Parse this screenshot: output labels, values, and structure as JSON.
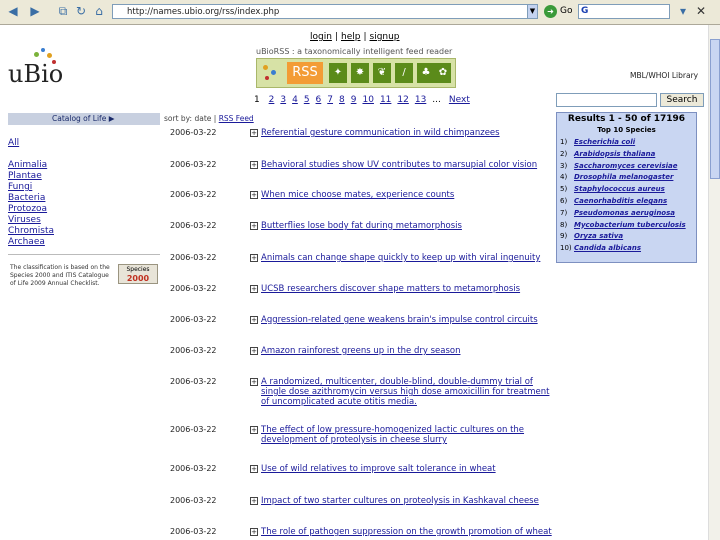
{
  "browser": {
    "address": "http://names.ubio.org/rss/index.php",
    "go_label": "Go",
    "search_value": "G"
  },
  "header": {
    "login": "login",
    "help": "help",
    "signup": "signup",
    "tagline": "uBioRSS : a taxonomically intelligent feed reader",
    "logo_text": "uBio",
    "rss_label": "RSS",
    "affiliation": "MBL/WHOI Library"
  },
  "pager": {
    "pages": [
      "2",
      "3",
      "4",
      "5",
      "6",
      "7",
      "8",
      "9",
      "10",
      "11",
      "12",
      "13"
    ],
    "current": "1",
    "ellipsis": "...",
    "next": "Next"
  },
  "search": {
    "button": "Search"
  },
  "catalog": {
    "label": "Catalog of Life ▶",
    "sort_text": "sort by: date |",
    "rss_feed": "RSS Feed",
    "items": [
      "All",
      "Animalia",
      "Plantae",
      "Fungi",
      "Bacteria",
      "Protozoa",
      "Viruses",
      "Chromista",
      "Archaea"
    ],
    "note": "The classification is based on the Species 2000 and ITIS Catalogue of Life 2009 Annual Checklist.",
    "badge_top": "Species",
    "badge_bottom": "2000"
  },
  "feeds": [
    {
      "date": "2006-03-22",
      "title": "Referential gesture communication in wild chimpanzees"
    },
    {
      "date": "2006-03-22",
      "title": "Behavioral studies show UV contributes to marsupial color vision"
    },
    {
      "date": "2006-03-22",
      "title": "When mice choose mates, experience counts"
    },
    {
      "date": "2006-03-22",
      "title": "Butterflies lose body fat during metamorphosis"
    },
    {
      "date": "2006-03-22",
      "title": "Animals can change shape quickly to keep up with viral ingenuity"
    },
    {
      "date": "2006-03-22",
      "title": "UCSB researchers discover shape matters to metamorphosis"
    },
    {
      "date": "2006-03-22",
      "title": "Aggression-related gene weakens brain's impulse control circuits"
    },
    {
      "date": "2006-03-22",
      "title": "Amazon rainforest greens up in the dry season"
    },
    {
      "date": "2006-03-22",
      "title": "A randomized, multicenter, double-blind, double-dummy trial of single dose azithromycin versus high dose amoxicillin for treatment of uncomplicated acute otitis media."
    },
    {
      "date": "2006-03-22",
      "title": "The effect of low pressure-homogenized lactic cultures on the development of proteolysis in cheese slurry"
    },
    {
      "date": "2006-03-22",
      "title": "Use of wild relatives to improve salt tolerance in wheat"
    },
    {
      "date": "2006-03-22",
      "title": "Impact of two starter cultures on proteolysis in Kashkaval cheese"
    },
    {
      "date": "2006-03-22",
      "title": "The role of pathogen suppression on the growth promotion of wheat"
    }
  ],
  "results": {
    "heading": "Results 1 - 50 of 17196",
    "subheading": "Top 10 Species",
    "species": [
      {
        "n": "1)",
        "name": "Escherichia coli"
      },
      {
        "n": "2)",
        "name": "Arabidopsis thaliana"
      },
      {
        "n": "3)",
        "name": "Saccharomyces cerevisiae"
      },
      {
        "n": "4)",
        "name": "Drosophila melanogaster"
      },
      {
        "n": "5)",
        "name": "Staphylococcus aureus"
      },
      {
        "n": "6)",
        "name": "Caenorhabditis elegans"
      },
      {
        "n": "7)",
        "name": "Pseudomonas aeruginosa"
      },
      {
        "n": "8)",
        "name": "Mycobacterium tuberculosis"
      },
      {
        "n": "9)",
        "name": "Oryza sativa"
      },
      {
        "n": "10)",
        "name": "Candida albicans"
      }
    ]
  },
  "colors": {
    "link": "#1a1a9a",
    "results_bg": "#c9d6f2",
    "rss_orange": "#f39c35",
    "rss_banner": "#d7e2a6"
  }
}
